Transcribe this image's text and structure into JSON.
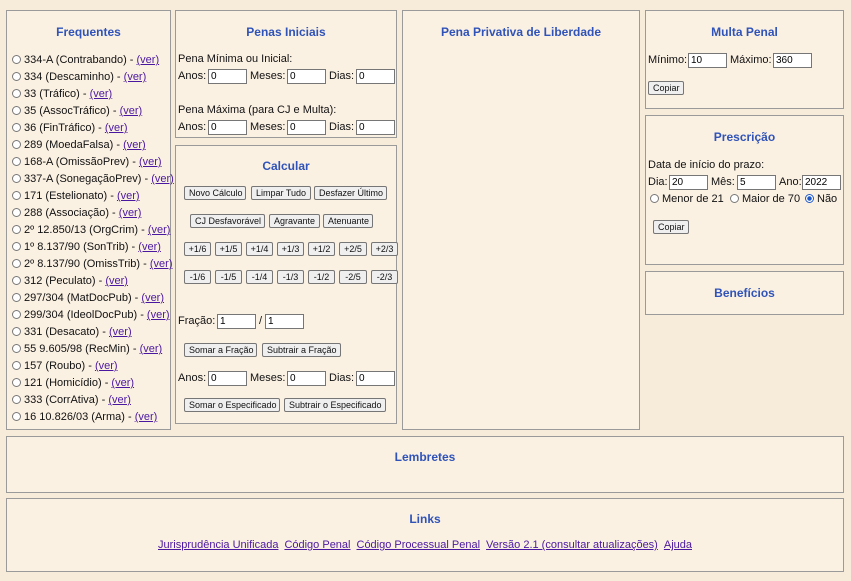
{
  "frequentes": {
    "title": "Frequentes",
    "ver_label": "(ver)",
    "items": [
      "334-A (Contrabando) -",
      "334 (Descaminho) -",
      "33 (Tráfico) -",
      "35 (AssocTráfico) -",
      "36 (FinTráfico) -",
      "289 (MoedaFalsa) -",
      "168-A (OmissãoPrev) -",
      "337-A (SonegaçãoPrev) -",
      "171 (Estelionato) -",
      "288 (Associação) -",
      "2º 12.850/13 (OrgCrim) -",
      "1º 8.137/90 (SonTrib) -",
      "2º 8.137/90 (OmissTrib) -",
      "312 (Peculato) -",
      "297/304 (MatDocPub) -",
      "299/304 (IdeolDocPub) -",
      "331 (Desacato) -",
      "55 9.605/98 (RecMin) -",
      "157 (Roubo) -",
      "121 (Homicídio) -",
      "333 (CorrAtiva) -",
      "16 10.826/03 (Arma) -"
    ]
  },
  "penas_iniciais": {
    "title": "Penas Iniciais",
    "minima_label": "Pena Mínima ou Inicial:",
    "maxima_label": "Pena Máxima (para CJ e Multa):",
    "anos_label": "Anos:",
    "meses_label": "Meses:",
    "dias_label": "Dias:",
    "min": {
      "anos": "0",
      "meses": "0",
      "dias": "0"
    },
    "max": {
      "anos": "0",
      "meses": "0",
      "dias": "0"
    }
  },
  "calcular": {
    "title": "Calcular",
    "row1": [
      "Novo Cálculo",
      "Limpar Tudo",
      "Desfazer Último"
    ],
    "row2": [
      "CJ Desfavorável",
      "Agravante",
      "Atenuante"
    ],
    "plus": [
      "+1/6",
      "+1/5",
      "+1/4",
      "+1/3",
      "+1/2",
      "+2/5",
      "+2/3"
    ],
    "minus": [
      "-1/6",
      "-1/5",
      "-1/4",
      "-1/3",
      "-1/2",
      "-2/5",
      "-2/3"
    ],
    "fracao_label": "Fração:",
    "fracao_sep": "/",
    "fracao_num": "1",
    "fracao_den": "1",
    "somar_fracao": "Somar a Fração",
    "subtrair_fracao": "Subtrair a Fração",
    "anos_label": "Anos:",
    "meses_label": "Meses:",
    "dias_label": "Dias:",
    "anos": "0",
    "meses": "0",
    "dias": "0",
    "somar_especificado": "Somar o Especificado",
    "subtrair_especificado": "Subtrair o Especificado"
  },
  "pena_privativa": {
    "title": "Pena Privativa de Liberdade"
  },
  "multa": {
    "title": "Multa Penal",
    "minimo_label": "Mínimo:",
    "maximo_label": "Máximo:",
    "minimo": "10",
    "maximo": "360",
    "copiar": "Copiar"
  },
  "prescricao": {
    "title": "Prescrição",
    "data_label": "Data de início do prazo:",
    "dia_label": "Dia:",
    "mes_label": "Mês:",
    "ano_label": "Ano:",
    "dia": "20",
    "mes": "5",
    "ano": "2022",
    "opt_menor": "Menor de 21",
    "opt_maior": "Maior de 70",
    "opt_nao": "Não",
    "copiar": "Copiar"
  },
  "beneficios": {
    "title": "Benefícios"
  },
  "lembretes": {
    "title": "Lembretes"
  },
  "links": {
    "title": "Links",
    "items": [
      "Jurisprudência Unificada",
      "Código Penal",
      "Código Processual Penal",
      "Versão 2.1 (consultar atualizações)",
      "Ajuda"
    ]
  }
}
